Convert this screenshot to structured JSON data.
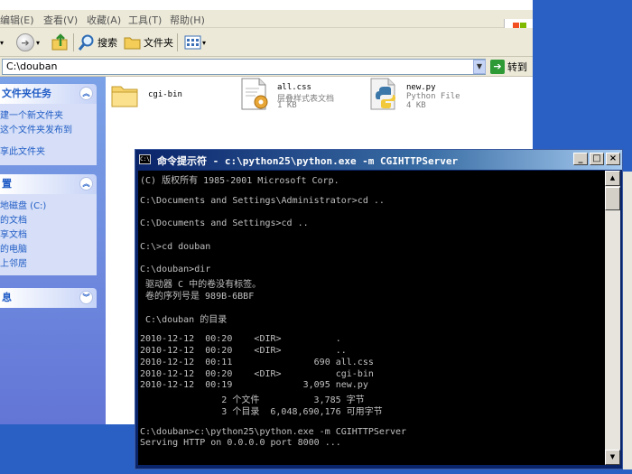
{
  "explorer": {
    "menu": [
      "编辑(E)",
      "查看(V)",
      "收藏(A)",
      "工具(T)",
      "帮助(H)"
    ],
    "toolbar": {
      "search_label": "搜索",
      "folders_label": "文件夹"
    },
    "address": {
      "value": "C:\\douban",
      "go_label": "转到"
    },
    "taskpane": {
      "folder_tasks_header": "文件夹任务",
      "folder_tasks": [
        "建一个新文件夹",
        "这个文件夹发布到",
        "",
        "享此文件夹"
      ],
      "other_places_header": "置",
      "other_places": [
        "地磁盘 (C:)",
        "的文档",
        "享文档",
        "的电脑",
        "上邻居"
      ],
      "details_header": "息"
    },
    "files": [
      {
        "name": "cgi-bin",
        "type": "",
        "size": ""
      },
      {
        "name": "all.css",
        "type": "层叠样式表文档",
        "size": "1 KB"
      },
      {
        "name": "new.py",
        "type": "Python File",
        "size": "4 KB"
      }
    ]
  },
  "cmd": {
    "icon_label": "C:\\",
    "title": "命令提示符 - c:\\python25\\python.exe -m CGIHTTPServer",
    "lines": [
      "(C) 版权所有 1985-2001 Microsoft Corp.",
      "",
      "C:\\Documents and Settings\\Administrator>cd ..",
      "",
      "C:\\Documents and Settings>cd ..",
      "",
      "C:\\>cd douban",
      "",
      "C:\\douban>dir",
      " 驱动器 C 中的卷没有标签。",
      " 卷的序列号是 989B-6BBF",
      "",
      " C:\\douban 的目录",
      "",
      "2010-12-12  00:20    <DIR>          .",
      "2010-12-12  00:20    <DIR>          ..",
      "2010-12-12  00:11               690 all.css",
      "2010-12-12  00:20    <DIR>          cgi-bin",
      "2010-12-12  00:19             3,095 new.py",
      "               2 个文件          3,785 字节",
      "               3 个目录  6,048,690,176 可用字节",
      "",
      "C:\\douban>c:\\python25\\python.exe -m CGIHTTPServer",
      "Serving HTTP on 0.0.0.0 port 8000 ..."
    ]
  }
}
